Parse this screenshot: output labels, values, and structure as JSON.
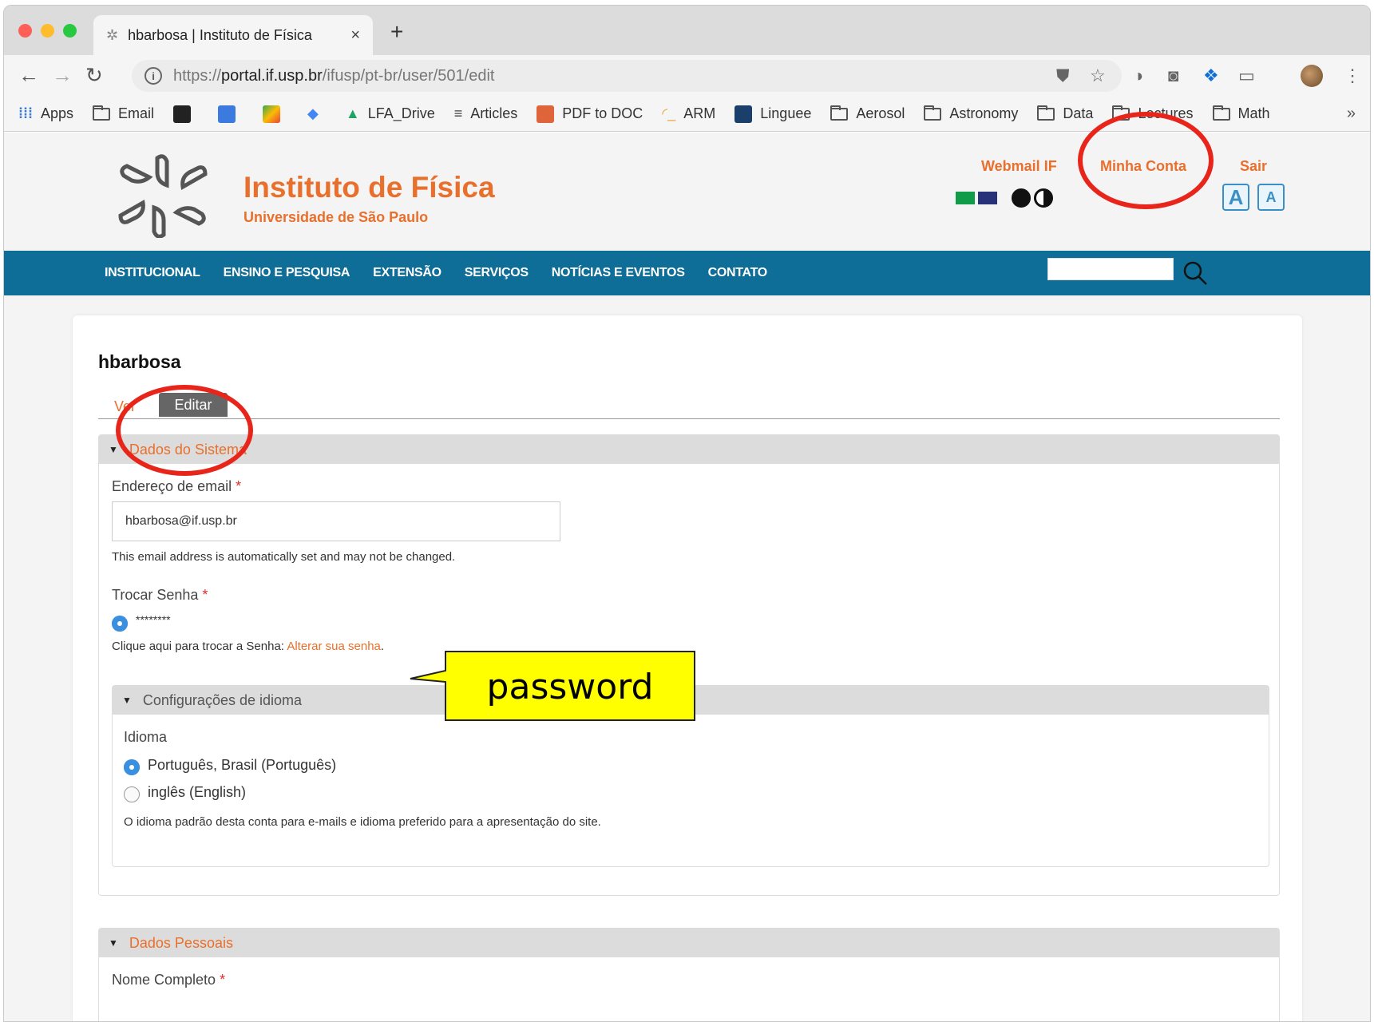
{
  "browser": {
    "tab_title": "hbarbosa | Instituto de Física",
    "url_prefix": "https://",
    "url_host": "portal.if.usp.br",
    "url_path": "/ifusp/pt-br/user/501/edit",
    "bookmarks": [
      "Apps",
      "Email",
      "LFA_Drive",
      "Articles",
      "PDF to DOC",
      "ARM",
      "Linguee",
      "Aerosol",
      "Astronomy",
      "Data",
      "Lectures",
      "Math"
    ],
    "more": "»"
  },
  "site": {
    "title": "Instituto de Física",
    "subtitle": "Universidade de São Paulo",
    "links": {
      "webmail": "Webmail IF",
      "account": "Minha Conta",
      "logout": "Sair"
    },
    "nav": [
      "INSTITUCIONAL",
      "ENSINO E PESQUISA",
      "EXTENSÃO",
      "SERVIÇOS",
      "NOTÍCIAS E EVENTOS",
      "CONTATO"
    ],
    "colors": {
      "accent": "#e96f2c",
      "nav_bg": "#0f6e97",
      "annotation": "#e8251b",
      "callout": "#ffff00"
    }
  },
  "profile": {
    "username": "hbarbosa",
    "tabs": {
      "view": "Ver",
      "edit": "Editar"
    },
    "system": {
      "legend": "Dados do Sistema",
      "email_label": "Endereço de email",
      "required_mark": "*",
      "email_value": "hbarbosa@if.usp.br",
      "email_help": "This email address is automatically set and may not be changed.",
      "password_label": "Trocar Senha",
      "password_value": "********",
      "password_help": "Clique aqui para trocar a Senha: ",
      "password_link": "Alterar sua senha",
      "password_help_end": "."
    },
    "language": {
      "legend": "Configurações de idioma",
      "label": "Idioma",
      "options": [
        "Português, Brasil (Português)",
        "inglês (English)"
      ],
      "selected": "Português, Brasil (Português)",
      "help": "O idioma padrão desta conta para e-mails e idioma preferido para a apresentação do site."
    },
    "personal": {
      "legend": "Dados Pessoais",
      "name_label": "Nome Completo"
    }
  },
  "annotation": {
    "callout": "password"
  }
}
